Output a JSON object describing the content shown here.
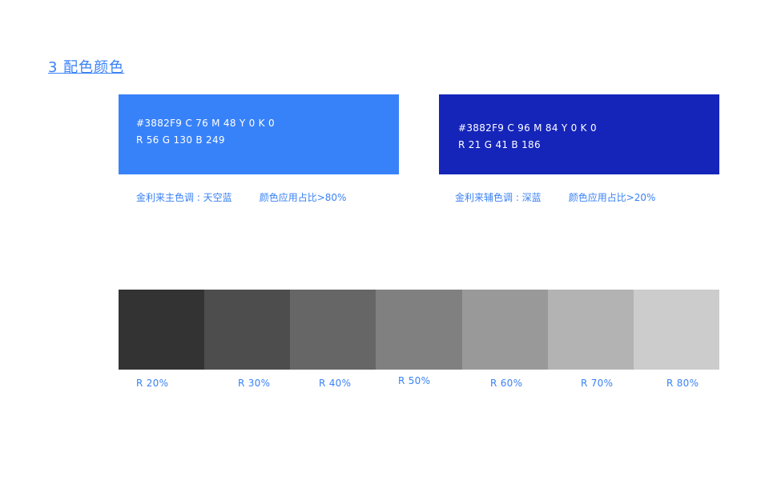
{
  "page": {
    "title": "3  配色颜色"
  },
  "colors": {
    "primary": {
      "hex": "#3882F9",
      "line1": "#3882F9   C 76   M 48   Y 0   K 0",
      "line2": "R 56   G 130   B 249",
      "caption_name": "金利来主色调 : 天空蓝",
      "caption_usage": "颜色应用占比>80%"
    },
    "secondary": {
      "hex": "#1525BA",
      "line1": "#3882F9   C 96  M 84   Y 0   K 0",
      "line2": "R 21   G 41   B 186",
      "caption_name": "金利来辅色调 : 深蓝",
      "caption_usage": "颜色应用占比>20%"
    }
  },
  "grays": [
    {
      "hex": "#333333",
      "label": "R  20%"
    },
    {
      "hex": "#4d4d4d",
      "label": "R  30%"
    },
    {
      "hex": "#666666",
      "label": "R  40%"
    },
    {
      "hex": "#808080",
      "label": "R  50%"
    },
    {
      "hex": "#999999",
      "label": "R  60%"
    },
    {
      "hex": "#b3b3b3",
      "label": "R  70%"
    },
    {
      "hex": "#cccccc",
      "label": "R  80%"
    }
  ],
  "theme": {
    "accent": "#3a82f6"
  }
}
